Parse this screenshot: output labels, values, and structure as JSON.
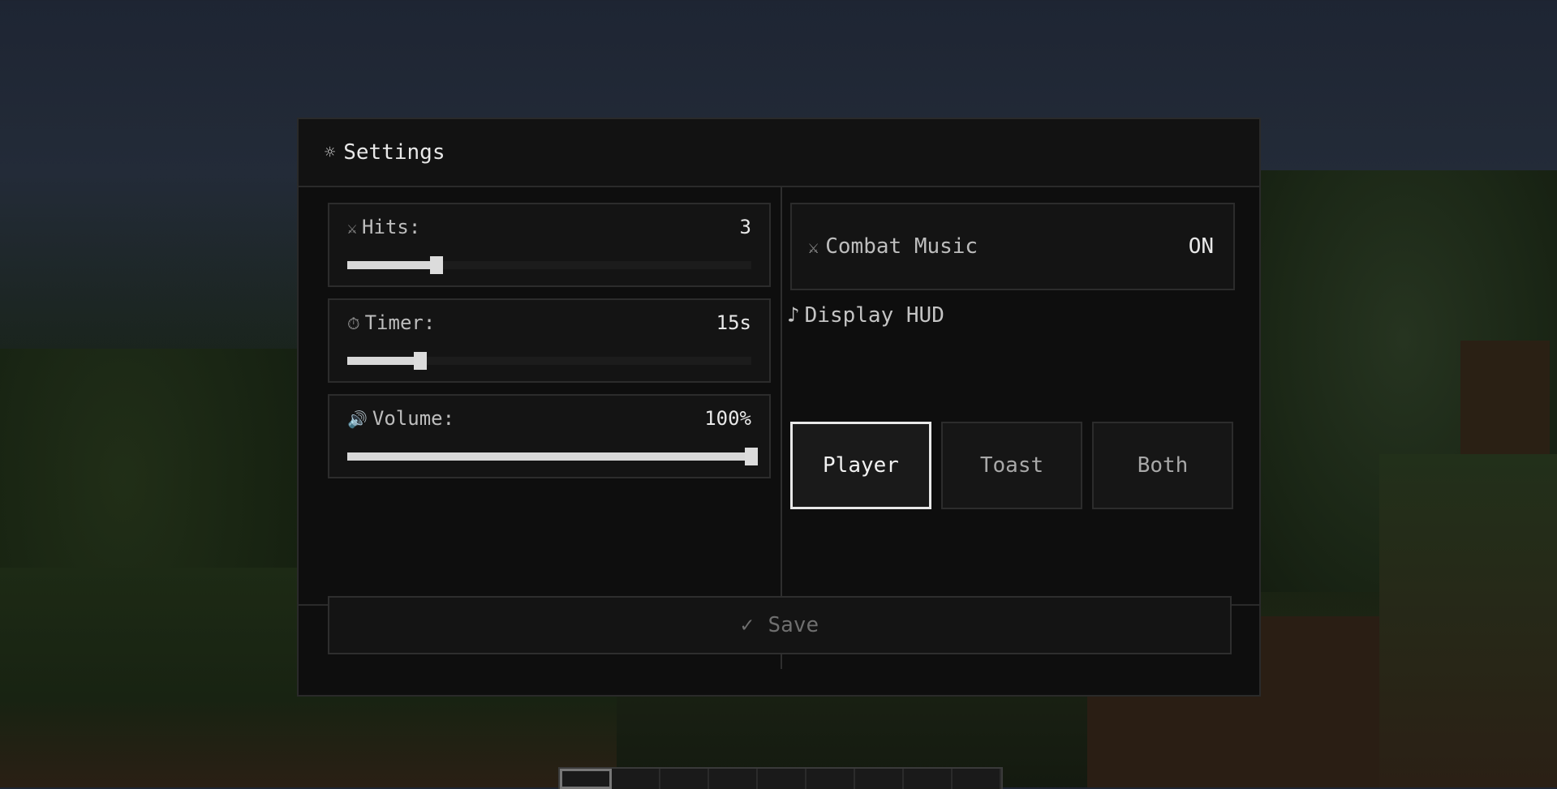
{
  "header": {
    "icon": "gear-icon",
    "title": "Settings"
  },
  "sliders": [
    {
      "icon": "crossed-swords-icon",
      "label": "Hits:",
      "value": "3",
      "fraction": 0.22
    },
    {
      "icon": "stopwatch-icon",
      "label": "Timer:",
      "value": "15s",
      "fraction": 0.18
    },
    {
      "icon": "speaker-icon",
      "label": "Volume:",
      "value": "100%",
      "fraction": 1.0
    }
  ],
  "combat_music": {
    "icon": "crossed-swords-icon",
    "label": "Combat Music",
    "value": "ON"
  },
  "display_hud": {
    "icon": "music-note-icon",
    "label": "Display HUD"
  },
  "modes": [
    {
      "label": "Player",
      "active": true
    },
    {
      "label": "Toast",
      "active": false
    },
    {
      "label": "Both",
      "active": false
    }
  ],
  "save": {
    "icon": "checkmark-icon",
    "label": "Save"
  },
  "hotbar": {
    "slots": 9,
    "selected": 0
  }
}
